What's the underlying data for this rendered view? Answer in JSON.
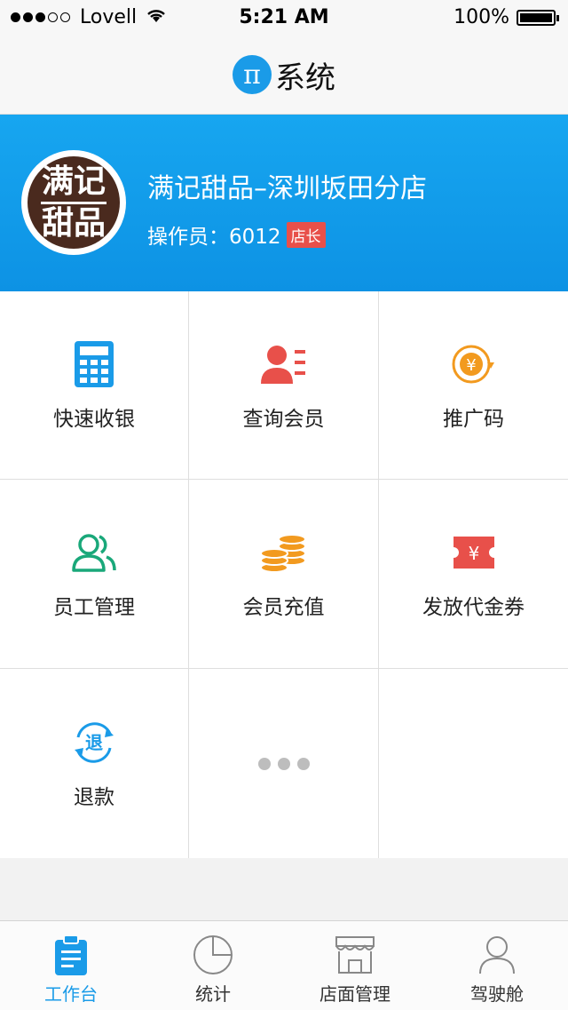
{
  "status_bar": {
    "carrier": "Lovell",
    "time": "5:21 AM",
    "battery": "100%"
  },
  "nav": {
    "logo_glyph": "π",
    "title": "系统"
  },
  "store": {
    "logo_line1": "满记",
    "logo_line2": "甜品",
    "name": "满记甜品–深圳坂田分店",
    "operator_label": "操作员：6012",
    "role_badge": "店长"
  },
  "menu": [
    {
      "label": "快速收银",
      "icon": "calculator-icon"
    },
    {
      "label": "查询会员",
      "icon": "member-search-icon"
    },
    {
      "label": "推广码",
      "icon": "yuan-refresh-icon"
    },
    {
      "label": "员工管理",
      "icon": "staff-icon"
    },
    {
      "label": "会员充值",
      "icon": "coins-icon"
    },
    {
      "label": "发放代金券",
      "icon": "voucher-icon"
    },
    {
      "label": "退款",
      "icon": "refund-icon"
    },
    {
      "label": "",
      "icon": "more-icon"
    },
    {
      "label": "",
      "icon": ""
    }
  ],
  "refund_glyph": "退",
  "tabs": [
    {
      "label": "工作台",
      "active": true
    },
    {
      "label": "统计"
    },
    {
      "label": "店面管理"
    },
    {
      "label": "驾驶舱"
    }
  ],
  "colors": {
    "accent": "#1a9be8",
    "header": "#0d92e4",
    "red": "#e8504a",
    "orange": "#f29a1f",
    "green": "#1aa87a"
  }
}
